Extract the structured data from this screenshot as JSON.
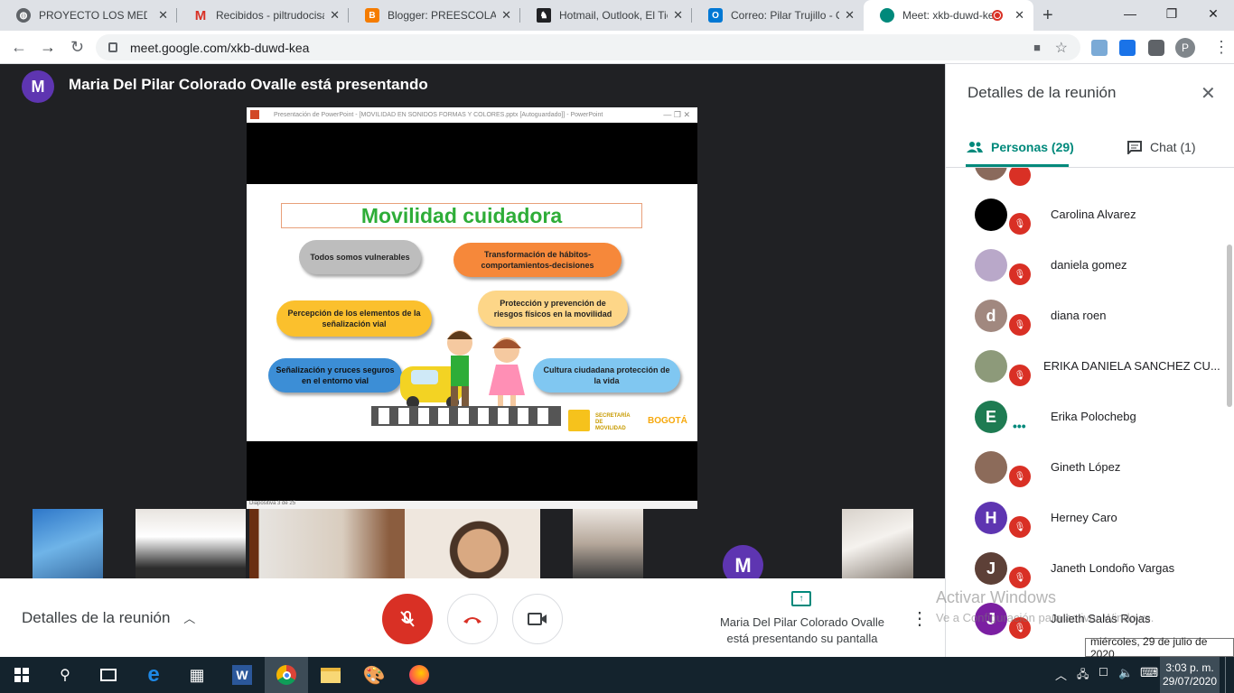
{
  "browser": {
    "tabs": [
      {
        "title": "PROYECTO LOS MEDIOS",
        "icon": "globe-icon",
        "color": "#5f6368"
      },
      {
        "title": "Recibidos - piltrudocisa",
        "icon": "gmail-icon",
        "color": "#d93025"
      },
      {
        "title": "Blogger: PREESCOLAR",
        "icon": "blogger-icon",
        "color": "#f57c00"
      },
      {
        "title": "Hotmail, Outlook, El Tie",
        "icon": "msn-icon",
        "color": "#202124"
      },
      {
        "title": "Correo: Pilar Trujillo - O",
        "icon": "outlook-icon",
        "color": "#0078d4"
      },
      {
        "title": "Meet: xkb-duwd-ke",
        "icon": "meet-icon",
        "color": "#00897b"
      }
    ],
    "url": "meet.google.com/xkb-duwd-kea",
    "profile_initial": "P"
  },
  "presenter": {
    "initial": "M",
    "text": "Maria Del Pilar Colorado Ovalle está presentando"
  },
  "ppt": {
    "window_title": "Presentación de PowerPoint - [MOVILIDAD EN SONIDOS FORMAS Y COLORES.pptx [Autoguardado]] - PowerPoint",
    "status": "Diapositiva 3 de 25"
  },
  "slide": {
    "title": "Movilidad cuidadora",
    "pills": [
      "Todos somos vulnerables",
      "Transformación de hábitos-comportamientos-decisiones",
      "Percepción de los elementos de la señalización vial",
      "Protección y prevención de riesgos  físicos en la movilidad",
      "Señalización y cruces seguros en el entorno vial",
      "Cultura ciudadana protección de la vida"
    ],
    "logos": [
      "SECRETARÍA DE MOVILIDAD",
      "BOGOTÁ"
    ]
  },
  "thumbs": {
    "presenter_initial": "M"
  },
  "bottom": {
    "details_label": "Detalles de la reunión",
    "presenting_text": "Maria Del Pilar Colorado Ovalle está presentando su pantalla"
  },
  "sidebar": {
    "title": "Detalles de la reunión",
    "tab_people": "Personas (29)",
    "tab_chat": "Chat (1)",
    "people": [
      {
        "name": "Carolina Alvarez",
        "initial": "",
        "color": "#000000",
        "muted": true
      },
      {
        "name": "daniela gomez",
        "initial": "",
        "color": "#b9a8c9",
        "muted": true
      },
      {
        "name": "diana roen",
        "initial": "d",
        "color": "#a1887f",
        "muted": true
      },
      {
        "name": "ERIKA DANIELA SANCHEZ CU...",
        "initial": "",
        "color": "#8d9a7a",
        "muted": true
      },
      {
        "name": "Erika Polochebg",
        "initial": "E",
        "color": "#1e7b52",
        "muted": false
      },
      {
        "name": "Gineth López",
        "initial": "",
        "color": "#8c6b5a",
        "muted": true
      },
      {
        "name": "Herney Caro",
        "initial": "H",
        "color": "#5e35b1",
        "muted": true
      },
      {
        "name": "Janeth Londoño Vargas",
        "initial": "J",
        "color": "#5d4037",
        "muted": true
      },
      {
        "name": "Julieth Salas Rojas",
        "initial": "J",
        "color": "#7b1fa2",
        "muted": true
      }
    ]
  },
  "watermark": {
    "line1": "Activar Windows",
    "line2": "Ve a Configuración para activar Windows."
  },
  "taskbar": {
    "time": "3:03 p. m.",
    "date": "29/07/2020",
    "tooltip": "miércoles, 29 de julio de 2020"
  }
}
